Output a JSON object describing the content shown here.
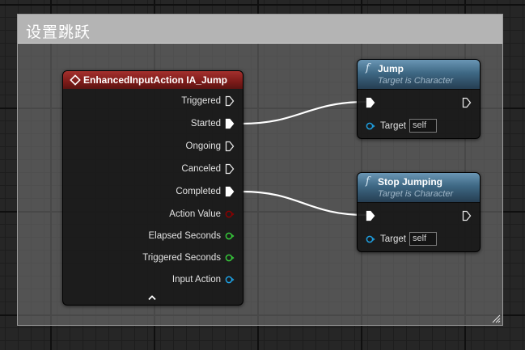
{
  "comment": {
    "title": "设置跳跃"
  },
  "event_node": {
    "title": "EnhancedInputAction IA_Jump",
    "pins": [
      {
        "label": "Triggered",
        "type": "exec",
        "connected": false
      },
      {
        "label": "Started",
        "type": "exec",
        "connected": true
      },
      {
        "label": "Ongoing",
        "type": "exec",
        "connected": false
      },
      {
        "label": "Canceled",
        "type": "exec",
        "connected": false
      },
      {
        "label": "Completed",
        "type": "exec",
        "connected": true
      },
      {
        "label": "Action Value",
        "type": "bool",
        "color": "#8b0000"
      },
      {
        "label": "Elapsed Seconds",
        "type": "float",
        "color": "#36c83a"
      },
      {
        "label": "Triggered Seconds",
        "type": "float",
        "color": "#36c83a"
      },
      {
        "label": "Input Action",
        "type": "object",
        "color": "#1e9fe0"
      }
    ]
  },
  "jump_node": {
    "icon": "f",
    "title": "Jump",
    "subtitle": "Target is Character",
    "target_label": "Target",
    "target_value": "self"
  },
  "stop_node": {
    "icon": "f",
    "title": "Stop Jumping",
    "subtitle": "Target is Character",
    "target_label": "Target",
    "target_value": "self"
  },
  "colors": {
    "event_header": "#8b2220",
    "function_header": "#3e6884",
    "exec_wire": "#ffffff",
    "object_pin": "#1e9fe0",
    "float_pin": "#36c83a",
    "bool_pin": "#8b0000"
  }
}
